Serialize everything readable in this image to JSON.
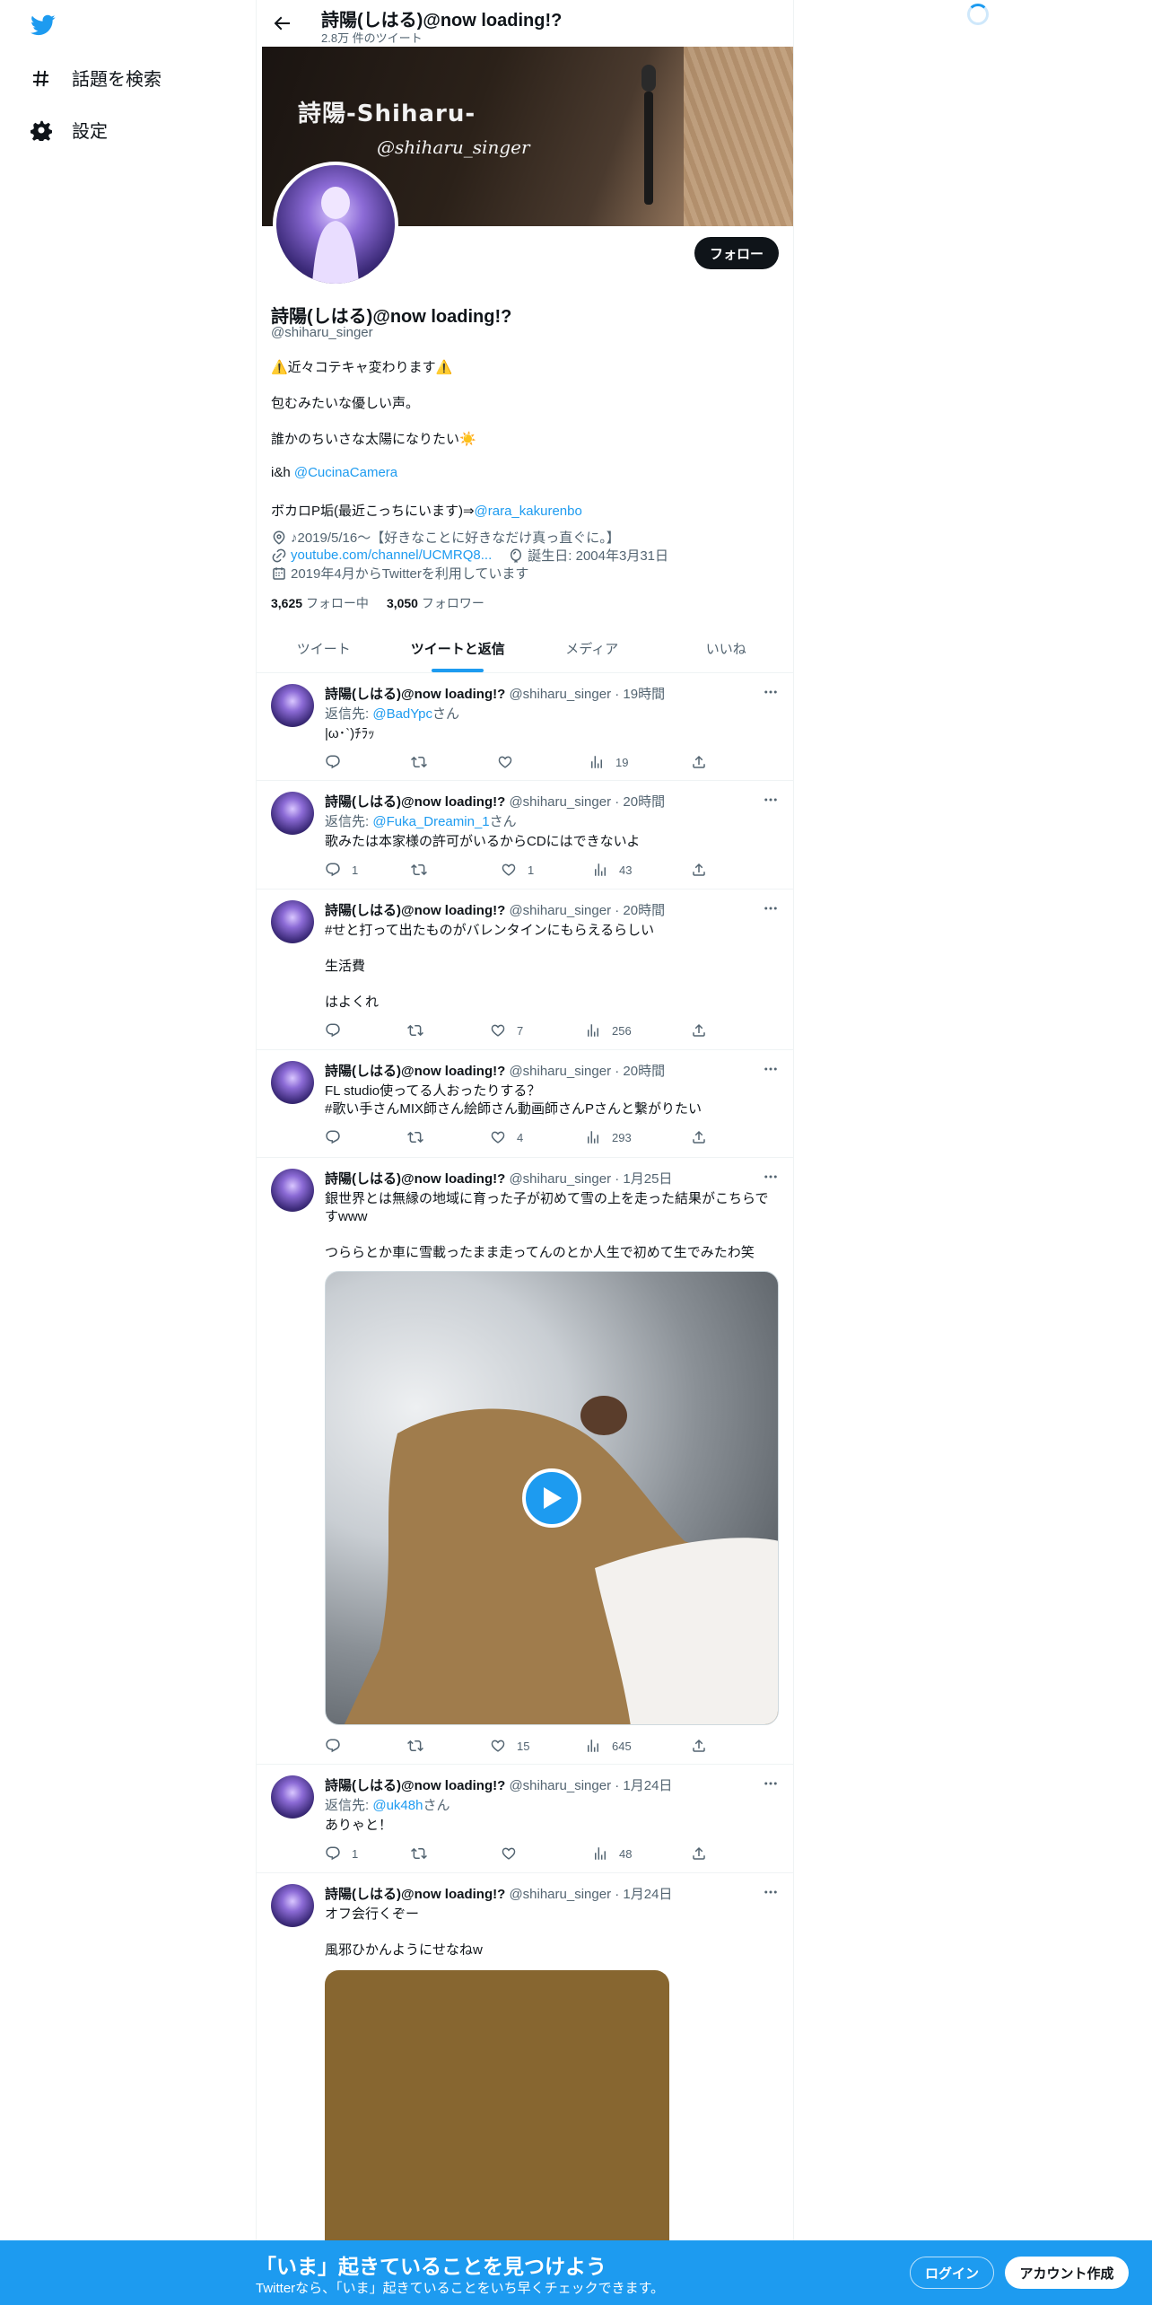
{
  "nav": {
    "items": [
      {
        "label": "話題を検索",
        "icon": "hashtag-icon"
      },
      {
        "label": "設定",
        "icon": "gear-icon"
      }
    ]
  },
  "header": {
    "title": "詩陽(しはる)@now loading!?",
    "subtitle": "2.8万 件のツイート"
  },
  "banner": {
    "title": "詩陽-Shiharu-",
    "handle": "@shiharu_singer"
  },
  "profile": {
    "follow_label": "フォロー",
    "name": "詩陽(しはる)@now loading!?",
    "handle": "@shiharu_singer",
    "bio_lines": [
      "⚠️近々コテキャ変わります⚠️",
      "包むみたいな優しい声。",
      "誰かのちいさな太陽になりたい☀️"
    ],
    "bio_ih_prefix": "i&h ",
    "bio_ih_link": "@CucinaCamera",
    "bio_vocalo_prefix": "ボカロP垢(最近こっちにいます)⇒",
    "bio_vocalo_link": "@rara_kakurenbo",
    "location": "♪2019/5/16〜【好きなことに好きなだけ真っ直ぐに。】",
    "website": "youtube.com/channel/UCMRQ8...",
    "birthday": "誕生日: 2004年3月31日",
    "joined": "2019年4月からTwitterを利用しています",
    "following_count": "3,625",
    "following_label": "フォロー中",
    "followers_count": "3,050",
    "followers_label": "フォロワー"
  },
  "tabs": [
    "ツイート",
    "ツイートと返信",
    "メディア",
    "いいね"
  ],
  "active_tab": "ツイートと返信",
  "tweets": [
    {
      "name": "詩陽(しはる)@now loading!?",
      "meta": "@shiharu_singer · 19時間",
      "reply_prefix": "返信先: ",
      "reply_to": "@BadYpc",
      "reply_suffix": "さん",
      "text": "|ω･`)ﾁﾗｯ",
      "replies": "",
      "retweets": "",
      "likes": "",
      "views": "19"
    },
    {
      "name": "詩陽(しはる)@now loading!?",
      "meta": "@shiharu_singer · 20時間",
      "reply_prefix": "返信先: ",
      "reply_to": "@Fuka_Dreamin_1",
      "reply_suffix": "さん",
      "text": "歌みたは本家様の許可がいるからCDにはできないよ",
      "replies": "1",
      "retweets": "",
      "likes": "1",
      "views": "43"
    },
    {
      "name": "詩陽(しはる)@now loading!?",
      "meta": "@shiharu_singer · 20時間",
      "hashtag": "#せと打って出たものがバレンタインにもらえるらしい",
      "line2": "生活費",
      "line3": "はよくれ",
      "replies": "",
      "retweets": "",
      "likes": "7",
      "views": "256"
    },
    {
      "name": "詩陽(しはる)@now loading!?",
      "meta": "@shiharu_singer · 20時間",
      "text": "FL studio使ってる人おったりする？",
      "hashtag": "#歌い手さんMIX師さん絵師さん動画師さんPさんと繋がりたい",
      "replies": "",
      "retweets": "",
      "likes": "4",
      "views": "293"
    },
    {
      "name": "詩陽(しはる)@now loading!?",
      "meta": "@shiharu_singer · 1月25日",
      "text1": "銀世界とは無縁の地域に育った子が初めて雪の上を走った結果がこちらで",
      "text2": "すwww",
      "text3": "つららとか車に雪載ったまま走ってんのとか人生で初めて生でみたわ笑",
      "replies": "",
      "retweets": "",
      "likes": "15",
      "views": "645"
    },
    {
      "name": "詩陽(しはる)@now loading!?",
      "meta": "@shiharu_singer · 1月24日",
      "reply_prefix": "返信先: ",
      "reply_to": "@uk48h",
      "reply_suffix": "さん",
      "text": "ありゃと！",
      "replies": "1",
      "retweets": "",
      "likes": "",
      "views": "48"
    },
    {
      "name": "詩陽(しはる)@now loading!?",
      "meta": "@shiharu_singer · 1月24日",
      "text1": "オフ会行くぞー",
      "text2": "風邪ひかんようにせなねw"
    }
  ],
  "bottom": {
    "title": "「いま」起きていることを見つけよう",
    "subtitle": "Twitterなら、「いま」起きていることをいち早くチェックできます。",
    "login": "ログイン",
    "signup": "アカウント作成"
  },
  "colors": {
    "accent": "#1d9bf0",
    "text": "#0f1419",
    "muted": "#536471"
  }
}
